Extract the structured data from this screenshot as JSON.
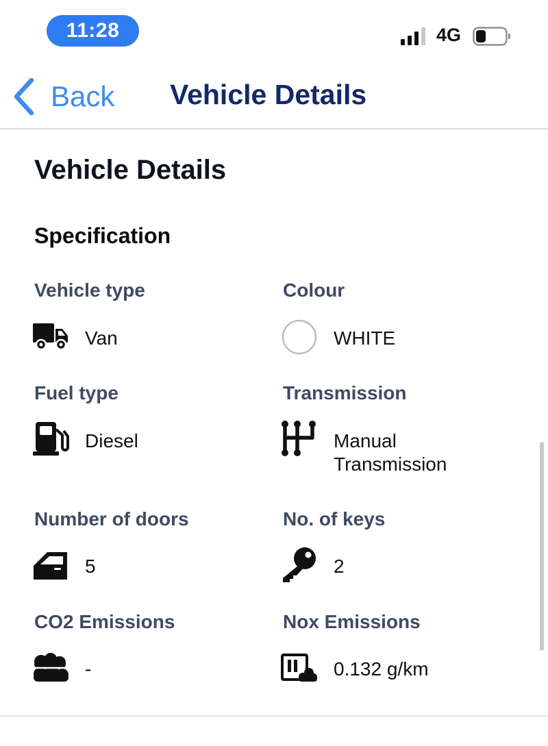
{
  "status_bar": {
    "time": "11:28",
    "network": "4G",
    "accent_color": "#2f7cf0",
    "battery_level": 0.3
  },
  "nav": {
    "back_label": "Back",
    "title": "Vehicle Details",
    "back_color": "#3d8bea",
    "title_color": "#12296a"
  },
  "page": {
    "section_title": "Vehicle Details",
    "subsection_title": "Specification"
  },
  "specs": {
    "vehicle_type": {
      "label": "Vehicle type",
      "value": "Van",
      "icon": "van-icon"
    },
    "colour": {
      "label": "Colour",
      "value": "WHITE",
      "icon": "colour-swatch-icon"
    },
    "fuel_type": {
      "label": "Fuel type",
      "value": "Diesel",
      "icon": "fuel-pump-icon"
    },
    "transmission": {
      "label": "Transmission",
      "value_line1": "Manual",
      "value_line2": "Transmission",
      "icon": "gear-shift-icon"
    },
    "doors": {
      "label": "Number of doors",
      "value": "5",
      "icon": "car-door-icon"
    },
    "keys": {
      "label": "No. of keys",
      "value": "2",
      "icon": "key-icon"
    },
    "co2": {
      "label": "CO2 Emissions",
      "value": "-",
      "icon": "clouds-icon"
    },
    "nox": {
      "label": "Nox Emissions",
      "value": "0.132 g/km",
      "icon": "factory-smoke-icon"
    }
  },
  "colors": {
    "label": "#3f4a62",
    "text": "#111111"
  }
}
